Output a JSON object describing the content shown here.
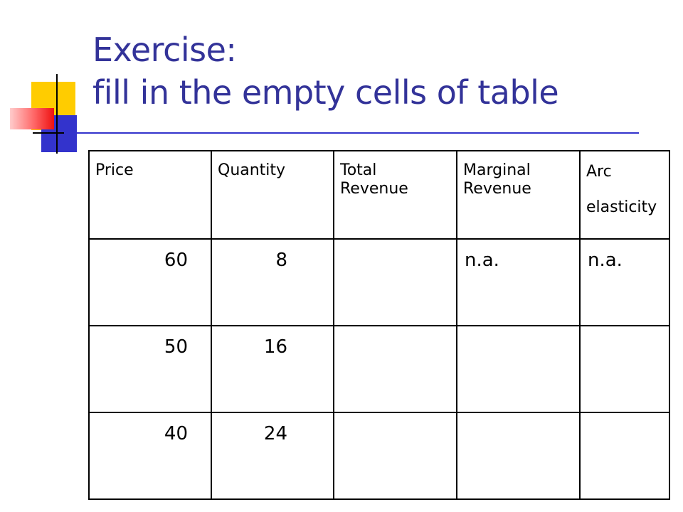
{
  "title": {
    "line1": "Exercise:",
    "line2": "fill in the empty cells of table"
  },
  "colors": {
    "title": "#333399",
    "accent_yellow": "#ffcc00",
    "accent_blue": "#3333cc",
    "accent_red": "#ee1111"
  },
  "table": {
    "headers": [
      {
        "line1": "Price",
        "line2": ""
      },
      {
        "line1": "Quantity",
        "line2": ""
      },
      {
        "line1": "Total",
        "line2": "Revenue"
      },
      {
        "line1": "Marginal",
        "line2": "Revenue"
      },
      {
        "line1": "Arc",
        "line2": "elasticity"
      }
    ],
    "rows": [
      {
        "price": "60",
        "quantity": "8",
        "total_revenue": "",
        "marginal_revenue": "n.a.",
        "arc_elasticity": "n.a."
      },
      {
        "price": "50",
        "quantity": "16",
        "total_revenue": "",
        "marginal_revenue": "",
        "arc_elasticity": ""
      },
      {
        "price": "40",
        "quantity": "24",
        "total_revenue": "",
        "marginal_revenue": "",
        "arc_elasticity": ""
      }
    ]
  }
}
